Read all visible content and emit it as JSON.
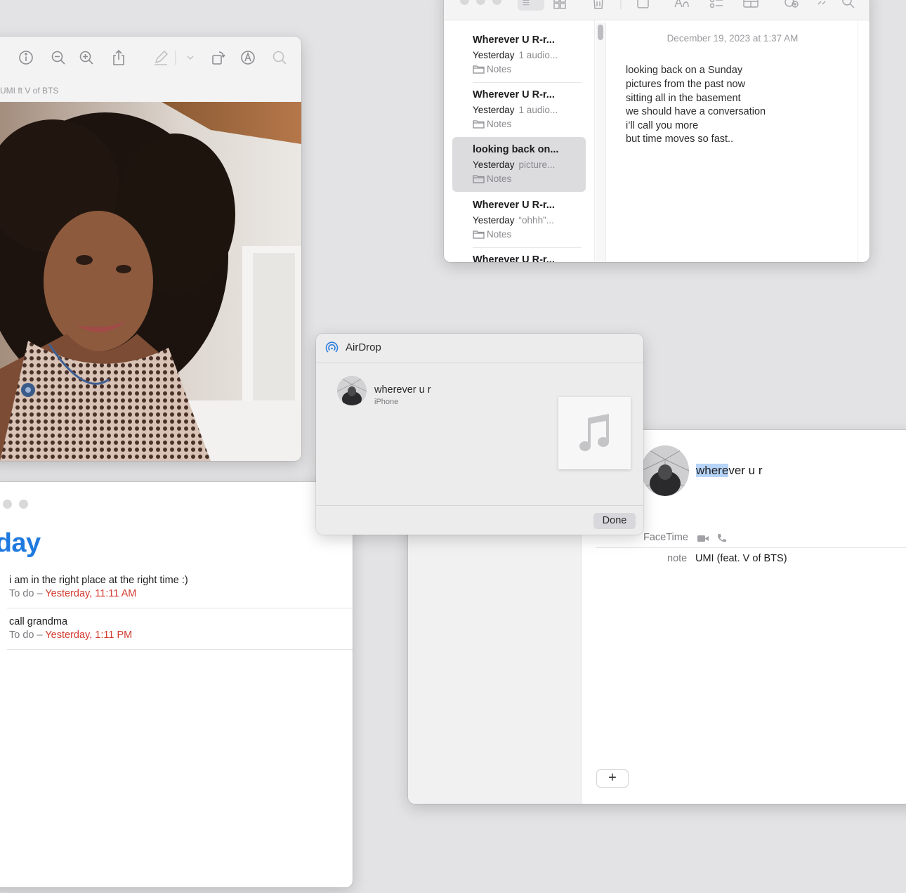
{
  "preview": {
    "subtitle": "UMI ft V of BTS",
    "toolbar": [
      "info-icon",
      "zoom-out-icon",
      "zoom-in-icon",
      "share-icon",
      "markup-pen-icon",
      "chevron-down-icon",
      "rotate-icon",
      "annotate-icon",
      "search-icon"
    ]
  },
  "notes": {
    "list": [
      {
        "title": "Wherever U R-r...",
        "date": "Yesterday",
        "preview": "1 audio...",
        "folder": "Notes"
      },
      {
        "title": "Wherever U R-r...",
        "date": "Yesterday",
        "preview": "1 audio...",
        "folder": "Notes"
      },
      {
        "title": "looking back on...",
        "date": "Yesterday",
        "preview": "picture...",
        "folder": "Notes"
      },
      {
        "title": "Wherever U R-r...",
        "date": "Yesterday",
        "preview": "“ohhh”...",
        "folder": "Notes"
      },
      {
        "title": "Wherever U R-r...",
        "date": "",
        "preview": "",
        "folder": ""
      }
    ],
    "selected_index": 2,
    "date": "December 19, 2023 at 1:37 AM",
    "body_lines": [
      "looking back on a Sunday",
      "pictures from the past now",
      "sitting all in the basement",
      "we should have a conversation",
      "i’ll call you more",
      "but time moves so fast.."
    ]
  },
  "reminders": {
    "heading": "oday",
    "items": [
      {
        "title": "i am in the right place at the right time :)",
        "list": "To do",
        "sep": " – ",
        "due": "Yesterday, 11:11 AM"
      },
      {
        "title": "call grandma",
        "list": "To do",
        "sep": " – ",
        "due": "Yesterday, 1:11 PM"
      }
    ],
    "due_color": "#d33b2f",
    "heading_color": "#1f7ae0"
  },
  "contacts": {
    "name_highlight": "where",
    "name_rest": "ver u r",
    "facetime_label": "FaceTime",
    "note_label": "note",
    "note_value": "UMI (feat. V of BTS)",
    "add_label": "+"
  },
  "airdrop": {
    "title": "AirDrop",
    "device_name": "wherever u r",
    "device_type": "iPhone",
    "done_label": "Done",
    "accent": "#2f7ee0"
  }
}
